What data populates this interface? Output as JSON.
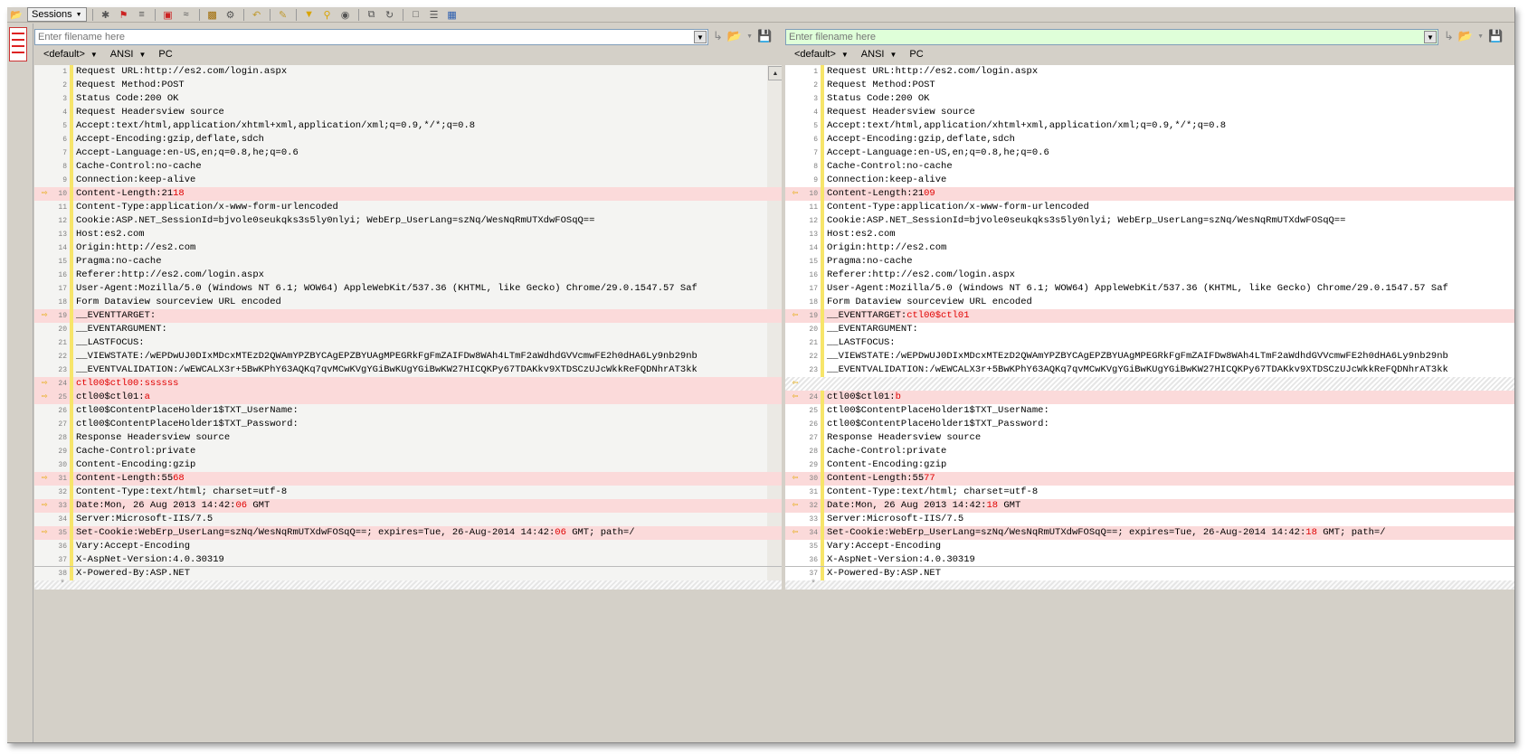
{
  "toolbar": {
    "sessions_label": "Sessions",
    "icons": [
      "open-folder-icon",
      "close-icon",
      "flag-icon",
      "equals-icon",
      "compare-icon",
      "approx-icon",
      "toolbox-icon",
      "gear-icon",
      "undo-icon",
      "edit-icon",
      "filter-icon",
      "pin-icon",
      "binoculars-icon",
      "copy-icon",
      "refresh-icon",
      "page-icon",
      "list-icon",
      "window-icon"
    ]
  },
  "left": {
    "filename_placeholder": "Enter filename here",
    "encoding": {
      "format": "<default>",
      "charset": "ANSI",
      "lineend": "PC"
    },
    "lines": [
      {
        "n": "1",
        "parts": [
          [
            "Request URL:http://es2.com/login.aspx",
            0
          ]
        ]
      },
      {
        "n": "2",
        "parts": [
          [
            "Request Method:POST",
            0
          ]
        ]
      },
      {
        "n": "3",
        "parts": [
          [
            "Status Code:200 OK",
            0
          ]
        ]
      },
      {
        "n": "4",
        "parts": [
          [
            "Request Headersview source",
            0
          ]
        ]
      },
      {
        "n": "5",
        "parts": [
          [
            "Accept:text/html,application/xhtml+xml,application/xml;q=0.9,*/*;q=0.8",
            0
          ]
        ]
      },
      {
        "n": "6",
        "parts": [
          [
            "Accept-Encoding:gzip,deflate,sdch",
            0
          ]
        ]
      },
      {
        "n": "7",
        "parts": [
          [
            "Accept-Language:en-US,en;q=0.8,he;q=0.6",
            0
          ]
        ]
      },
      {
        "n": "8",
        "parts": [
          [
            "Cache-Control:no-cache",
            0
          ]
        ]
      },
      {
        "n": "9",
        "parts": [
          [
            "Connection:keep-alive",
            0
          ]
        ]
      },
      {
        "n": "10",
        "diff": true,
        "parts": [
          [
            "Content-Length:21",
            0
          ],
          [
            "18",
            1
          ]
        ]
      },
      {
        "n": "11",
        "parts": [
          [
            "Content-Type:application/x-www-form-urlencoded",
            0
          ]
        ]
      },
      {
        "n": "12",
        "parts": [
          [
            "Cookie:ASP.NET_SessionId=bjvole0seukqks3s5ly0nlyi; WebErp_UserLang=szNq/WesNqRmUTXdwFOSqQ==",
            0
          ]
        ]
      },
      {
        "n": "13",
        "parts": [
          [
            "Host:es2.com",
            0
          ]
        ]
      },
      {
        "n": "14",
        "parts": [
          [
            "Origin:http://es2.com",
            0
          ]
        ]
      },
      {
        "n": "15",
        "parts": [
          [
            "Pragma:no-cache",
            0
          ]
        ]
      },
      {
        "n": "16",
        "parts": [
          [
            "Referer:http://es2.com/login.aspx",
            0
          ]
        ]
      },
      {
        "n": "17",
        "parts": [
          [
            "User-Agent:Mozilla/5.0 (Windows NT 6.1; WOW64) AppleWebKit/537.36 (KHTML, like Gecko) Chrome/29.0.1547.57 Saf",
            0
          ]
        ]
      },
      {
        "n": "18",
        "parts": [
          [
            "Form Dataview sourceview URL encoded",
            0
          ]
        ]
      },
      {
        "n": "19",
        "diff": true,
        "parts": [
          [
            "__EVENTTARGET:",
            0
          ]
        ]
      },
      {
        "n": "20",
        "parts": [
          [
            "__EVENTARGUMENT:",
            0
          ]
        ]
      },
      {
        "n": "21",
        "parts": [
          [
            "__LASTFOCUS:",
            0
          ]
        ]
      },
      {
        "n": "22",
        "parts": [
          [
            "__VIEWSTATE:/wEPDwUJ0DIxMDcxMTEzD2QWAmYPZBYCAgEPZBYUAgMPEGRkFgFmZAIFDw8WAh4LTmF2aWdhdGVVcmwFE2h0dHA6Ly9nb29nb",
            0
          ]
        ]
      },
      {
        "n": "23",
        "parts": [
          [
            "__EVENTVALIDATION:/wEWCALX3r+5BwKPhY63AQKq7qvMCwKVgYGiBwKUgYGiBwKW27HICQKPy67TDAKkv9XTDSCzUJcWkkReFQDNhrAT3kk",
            0
          ]
        ]
      },
      {
        "n": "24",
        "diff": true,
        "parts": [
          [
            "ctl00$ctl00:ssssss",
            1
          ]
        ]
      },
      {
        "n": "25",
        "diff": true,
        "parts": [
          [
            "ctl00$ctl01:",
            0
          ],
          [
            "a",
            1
          ]
        ]
      },
      {
        "n": "26",
        "parts": [
          [
            "ctl00$ContentPlaceHolder1$TXT_UserName:",
            0
          ]
        ]
      },
      {
        "n": "27",
        "parts": [
          [
            "ctl00$ContentPlaceHolder1$TXT_Password:",
            0
          ]
        ]
      },
      {
        "n": "28",
        "parts": [
          [
            "Response Headersview source",
            0
          ]
        ]
      },
      {
        "n": "29",
        "parts": [
          [
            "Cache-Control:private",
            0
          ]
        ]
      },
      {
        "n": "30",
        "parts": [
          [
            "Content-Encoding:gzip",
            0
          ]
        ]
      },
      {
        "n": "31",
        "diff": true,
        "parts": [
          [
            "Content-Length:55",
            0
          ],
          [
            "68",
            1
          ]
        ]
      },
      {
        "n": "32",
        "parts": [
          [
            "Content-Type:text/html; charset=utf-8",
            0
          ]
        ]
      },
      {
        "n": "33",
        "diff": true,
        "parts": [
          [
            "Date:Mon, 26 Aug 2013 14:42:",
            0
          ],
          [
            "06",
            1
          ],
          [
            " GMT",
            0
          ]
        ]
      },
      {
        "n": "34",
        "parts": [
          [
            "Server:Microsoft-IIS/7.5",
            0
          ]
        ]
      },
      {
        "n": "35",
        "diff": true,
        "parts": [
          [
            "Set-Cookie:WebErp_UserLang=szNq/WesNqRmUTXdwFOSqQ==; expires=Tue, 26-Aug-2014 14:42:",
            0
          ],
          [
            "06",
            1
          ],
          [
            " GMT; path=/",
            0
          ]
        ]
      },
      {
        "n": "36",
        "parts": [
          [
            "Vary:Accept-Encoding",
            0
          ]
        ]
      },
      {
        "n": "37",
        "parts": [
          [
            "X-AspNet-Version:4.0.30319",
            0
          ]
        ]
      },
      {
        "n": "38",
        "parts": [
          [
            "X-Powered-By:ASP.NET",
            0
          ]
        ]
      }
    ]
  },
  "right": {
    "filename_placeholder": "Enter filename here",
    "encoding": {
      "format": "<default>",
      "charset": "ANSI",
      "lineend": "PC"
    },
    "lines": [
      {
        "n": "1",
        "parts": [
          [
            "Request URL:http://es2.com/login.aspx",
            0
          ]
        ]
      },
      {
        "n": "2",
        "parts": [
          [
            "Request Method:POST",
            0
          ]
        ]
      },
      {
        "n": "3",
        "parts": [
          [
            "Status Code:200 OK",
            0
          ]
        ]
      },
      {
        "n": "4",
        "parts": [
          [
            "Request Headersview source",
            0
          ]
        ]
      },
      {
        "n": "5",
        "parts": [
          [
            "Accept:text/html,application/xhtml+xml,application/xml;q=0.9,*/*;q=0.8",
            0
          ]
        ]
      },
      {
        "n": "6",
        "parts": [
          [
            "Accept-Encoding:gzip,deflate,sdch",
            0
          ]
        ]
      },
      {
        "n": "7",
        "parts": [
          [
            "Accept-Language:en-US,en;q=0.8,he;q=0.6",
            0
          ]
        ]
      },
      {
        "n": "8",
        "parts": [
          [
            "Cache-Control:no-cache",
            0
          ]
        ]
      },
      {
        "n": "9",
        "parts": [
          [
            "Connection:keep-alive",
            0
          ]
        ]
      },
      {
        "n": "10",
        "diff": true,
        "parts": [
          [
            "Content-Length:21",
            0
          ],
          [
            "09",
            1
          ]
        ]
      },
      {
        "n": "11",
        "parts": [
          [
            "Content-Type:application/x-www-form-urlencoded",
            0
          ]
        ]
      },
      {
        "n": "12",
        "parts": [
          [
            "Cookie:ASP.NET_SessionId=bjvole0seukqks3s5ly0nlyi; WebErp_UserLang=szNq/WesNqRmUTXdwFOSqQ==",
            0
          ]
        ]
      },
      {
        "n": "13",
        "parts": [
          [
            "Host:es2.com",
            0
          ]
        ]
      },
      {
        "n": "14",
        "parts": [
          [
            "Origin:http://es2.com",
            0
          ]
        ]
      },
      {
        "n": "15",
        "parts": [
          [
            "Pragma:no-cache",
            0
          ]
        ]
      },
      {
        "n": "16",
        "parts": [
          [
            "Referer:http://es2.com/login.aspx",
            0
          ]
        ]
      },
      {
        "n": "17",
        "parts": [
          [
            "User-Agent:Mozilla/5.0 (Windows NT 6.1; WOW64) AppleWebKit/537.36 (KHTML, like Gecko) Chrome/29.0.1547.57 Saf",
            0
          ]
        ]
      },
      {
        "n": "18",
        "parts": [
          [
            "Form Dataview sourceview URL encoded",
            0
          ]
        ]
      },
      {
        "n": "19",
        "diff": true,
        "parts": [
          [
            "__EVENTTARGET:",
            0
          ],
          [
            "ctl00$ctl01",
            1
          ]
        ]
      },
      {
        "n": "20",
        "parts": [
          [
            "__EVENTARGUMENT:",
            0
          ]
        ]
      },
      {
        "n": "21",
        "parts": [
          [
            "__LASTFOCUS:",
            0
          ]
        ]
      },
      {
        "n": "22",
        "parts": [
          [
            "__VIEWSTATE:/wEPDwUJ0DIxMDcxMTEzD2QWAmYPZBYCAgEPZBYUAgMPEGRkFgFmZAIFDw8WAh4LTmF2aWdhdGVVcmwFE2h0dHA6Ly9nb29nb",
            0
          ]
        ]
      },
      {
        "n": "23",
        "parts": [
          [
            "__EVENTVALIDATION:/wEWCALX3r+5BwKPhY63AQKq7qvMCwKVgYGiBwKUgYGiBwKW27HICQKPy67TDAKkv9XTDSCzUJcWkkReFQDNhrAT3kk",
            0
          ]
        ]
      },
      {
        "n": "",
        "hatch": true,
        "parts": []
      },
      {
        "n": "24",
        "diff": true,
        "parts": [
          [
            "ctl00$ctl01:",
            0
          ],
          [
            "b",
            1
          ]
        ]
      },
      {
        "n": "25",
        "parts": [
          [
            "ctl00$ContentPlaceHolder1$TXT_UserName:",
            0
          ]
        ]
      },
      {
        "n": "26",
        "parts": [
          [
            "ctl00$ContentPlaceHolder1$TXT_Password:",
            0
          ]
        ]
      },
      {
        "n": "27",
        "parts": [
          [
            "Response Headersview source",
            0
          ]
        ]
      },
      {
        "n": "28",
        "parts": [
          [
            "Cache-Control:private",
            0
          ]
        ]
      },
      {
        "n": "29",
        "parts": [
          [
            "Content-Encoding:gzip",
            0
          ]
        ]
      },
      {
        "n": "30",
        "diff": true,
        "parts": [
          [
            "Content-Length:55",
            0
          ],
          [
            "77",
            1
          ]
        ]
      },
      {
        "n": "31",
        "parts": [
          [
            "Content-Type:text/html; charset=utf-8",
            0
          ]
        ]
      },
      {
        "n": "32",
        "diff": true,
        "parts": [
          [
            "Date:Mon, 26 Aug 2013 14:42:",
            0
          ],
          [
            "18",
            1
          ],
          [
            " GMT",
            0
          ]
        ]
      },
      {
        "n": "33",
        "parts": [
          [
            "Server:Microsoft-IIS/7.5",
            0
          ]
        ]
      },
      {
        "n": "34",
        "diff": true,
        "parts": [
          [
            "Set-Cookie:WebErp_UserLang=szNq/WesNqRmUTXdwFOSqQ==; expires=Tue, 26-Aug-2014 14:42:",
            0
          ],
          [
            "18",
            1
          ],
          [
            " GMT; path=/",
            0
          ]
        ]
      },
      {
        "n": "35",
        "parts": [
          [
            "Vary:Accept-Encoding",
            0
          ]
        ]
      },
      {
        "n": "36",
        "parts": [
          [
            "X-AspNet-Version:4.0.30319",
            0
          ]
        ]
      },
      {
        "n": "37",
        "parts": [
          [
            "X-Powered-By:ASP.NET",
            0
          ]
        ]
      }
    ]
  },
  "colors": {
    "diff_bg": "#fbdada",
    "diff_text": "#e00000",
    "gutter_bar": "#f7e56a",
    "right_filename_bg": "#dfffd9"
  },
  "eof_marker": "*"
}
